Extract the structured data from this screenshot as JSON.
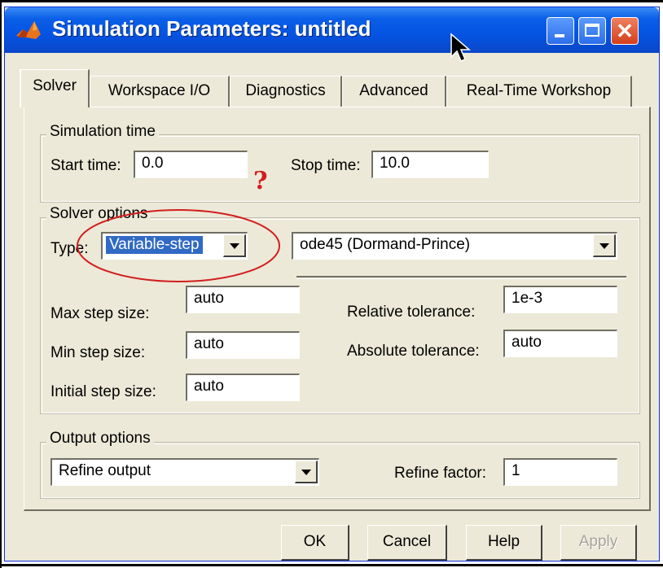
{
  "window": {
    "title": "Simulation Parameters: untitled",
    "buttons": [
      "minimize",
      "maximize",
      "close"
    ]
  },
  "tabs": [
    {
      "label": "Solver",
      "active": true
    },
    {
      "label": "Workspace I/O",
      "active": false
    },
    {
      "label": "Diagnostics",
      "active": false
    },
    {
      "label": "Advanced",
      "active": false
    },
    {
      "label": "Real-Time Workshop",
      "active": false
    }
  ],
  "simulation_time": {
    "legend": "Simulation time",
    "start_label": "Start time:",
    "start_value": "0.0",
    "stop_label": "Stop time:",
    "stop_value": "10.0"
  },
  "solver_options": {
    "legend": "Solver options",
    "type_label": "Type:",
    "type_value": "Variable-step",
    "solver_value": "ode45 (Dormand-Prince)",
    "max_step_label": "Max step size:",
    "max_step_value": "auto",
    "min_step_label": "Min step size:",
    "min_step_value": "auto",
    "initial_step_label": "Initial step size:",
    "initial_step_value": "auto",
    "rel_tol_label": "Relative tolerance:",
    "rel_tol_value": "1e-3",
    "abs_tol_label": "Absolute tolerance:",
    "abs_tol_value": "auto"
  },
  "output_options": {
    "legend": "Output options",
    "mode_value": "Refine output",
    "refine_label": "Refine factor:",
    "refine_value": "1"
  },
  "buttons": {
    "ok": "OK",
    "cancel": "Cancel",
    "help": "Help",
    "apply": "Apply"
  },
  "annotation": {
    "mark": "?",
    "color": "#d21e1e"
  },
  "colors": {
    "titlebar": "#0553e2",
    "dialog_bg": "#ece9d8",
    "selection": "#316ac5"
  }
}
